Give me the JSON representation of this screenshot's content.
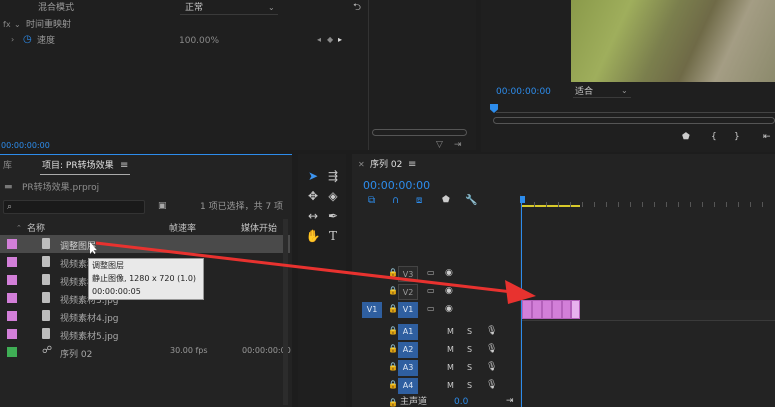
{
  "effect_controls": {
    "blend_mode_label": "混合模式",
    "blend_mode_value": "正常",
    "time_remap_label": "时间重映射",
    "speed_label": "速度",
    "speed_value": "100.00%",
    "timecode": "00:00:00:00"
  },
  "program_monitor": {
    "timecode": "00:00:00:00",
    "fit_value": "适合"
  },
  "project_panel": {
    "library_tab": "库",
    "tab_title": "项目: PR转场效果",
    "menu_glyph": "≡",
    "file_name": "PR转场效果.prproj",
    "selection_info": "1 项已选择，共 7 项",
    "col_name": "名称",
    "col_fps": "帧速率",
    "col_media_start": "媒体开始",
    "items": [
      {
        "name": "调整图层",
        "fps": "",
        "start": "",
        "color": "#d27fd8"
      },
      {
        "name": "视频素材1.jpg",
        "fps": "",
        "start": "",
        "color": "#d27fd8"
      },
      {
        "name": "视频素材2.jpg",
        "fps": "",
        "start": "",
        "color": "#d27fd8"
      },
      {
        "name": "视频素材3.jpg",
        "fps": "",
        "start": "",
        "color": "#d27fd8"
      },
      {
        "name": "视频素材4.jpg",
        "fps": "",
        "start": "",
        "color": "#d27fd8"
      },
      {
        "name": "视频素材5.jpg",
        "fps": "",
        "start": "",
        "color": "#d27fd8"
      },
      {
        "name": "序列 02",
        "fps": "30.00 fps",
        "start": "00:00:00:00",
        "color": "#3fae55"
      }
    ],
    "tooltip": {
      "title": "调整图层",
      "line2": "静止图像, 1280 x 720 (1.0)",
      "line3": "00:00:00:05"
    }
  },
  "timeline": {
    "tab_title": "序列 02",
    "menu_glyph": "≡",
    "timecode": "00:00:00:00",
    "video_tracks": [
      "V3",
      "V2",
      "V1"
    ],
    "audio_tracks": [
      "A1",
      "A2",
      "A3",
      "A4"
    ],
    "source_patch_v": "V1",
    "master_label": "主声道",
    "master_value": "0.0",
    "track_m": "M",
    "track_s": "S"
  },
  "colors": {
    "accent_blue": "#2d8ceb",
    "clip_pink": "#d27fd8",
    "sequence_green": "#3fae55",
    "arrow_red": "#e8322f",
    "work_area_yellow": "#d8c92a"
  }
}
